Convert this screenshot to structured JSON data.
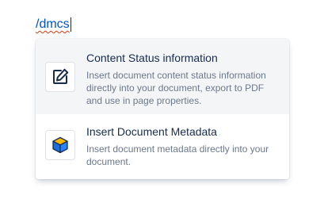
{
  "editor": {
    "typed_text": "/dmcs"
  },
  "menu": {
    "items": [
      {
        "title": "Content Status information",
        "description": "Insert document content status information directly into your document, export to PDF and use in page properties.",
        "icon": "edit-pencil-icon"
      },
      {
        "title": "Insert Document Metadata",
        "description": "Insert document metadata directly into your document.",
        "icon": "cube-icon"
      }
    ]
  },
  "colors": {
    "typed_text": "#0052cc",
    "active_item_bg": "#f4f5f7",
    "title": "#172b4d",
    "description": "#6b778c",
    "cube_front": "#1e6fd9",
    "cube_top": "#f5b800"
  }
}
